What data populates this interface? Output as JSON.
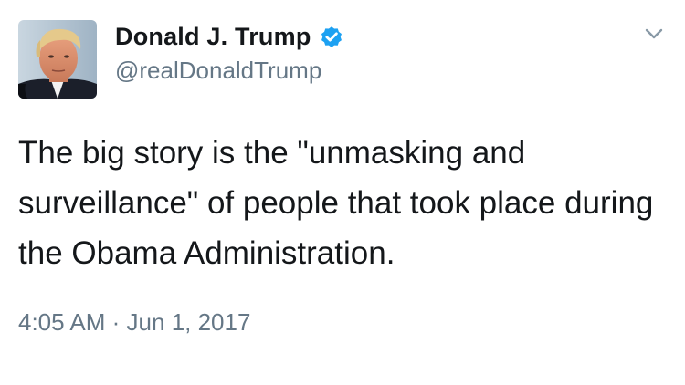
{
  "tweet": {
    "author": {
      "display_name": "Donald J. Trump",
      "handle": "@realDonaldTrump",
      "verified": true,
      "avatar_icon": "profile-photo"
    },
    "text": "The big story is the \"unmasking and surveillance\" of people that took place during the Obama Administration.",
    "time": "4:05 AM",
    "separator": "·",
    "date": "Jun 1, 2017",
    "menu_icon": "chevron-down-icon"
  },
  "colors": {
    "text_primary": "#14171a",
    "text_secondary": "#657786",
    "verified_blue": "#1da1f2",
    "divider": "#d8dde2",
    "background": "#ffffff"
  }
}
